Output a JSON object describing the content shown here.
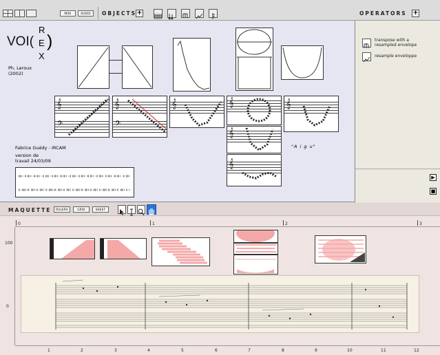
{
  "patch": {
    "toolbar": {
      "midi_label": "MIDI",
      "audio_label": "AUDIO",
      "objects_label": "OBJECTS",
      "add_symbol": "+"
    },
    "title": {
      "main": "VOI(",
      "letters": [
        "R",
        "E",
        "X"
      ],
      "close": ")",
      "author": "Ph. Leroux",
      "year": "(2002)"
    },
    "credits": {
      "line1": "Fabrice Guédy - IRCAM",
      "line2": "version de",
      "line3": "travail 24/03/09"
    },
    "aigu_label": "\"A i g u\"",
    "clef_symbol": "𝄞",
    "bass_symbol": "𝄢"
  },
  "operators": {
    "title": "OPERATORS",
    "add_symbol": "+",
    "items": [
      {
        "label_line1": "transpose with a",
        "label_line2": "resampled envelope",
        "icon": "transpose-icon"
      },
      {
        "label_line1": "resample enveloppe",
        "label_line2": "",
        "icon": "resample-icon"
      }
    ],
    "play_symbol": "▶",
    "stop_symbol": "■"
  },
  "maquette": {
    "title": "MAQUETTE",
    "buttons": [
      "RULERS",
      "GRID",
      "SHEET"
    ],
    "top_ruler": [
      "0",
      "1",
      "2",
      "3"
    ],
    "y_labels": [
      "100",
      "0"
    ],
    "bottom_ruler": [
      "1",
      "2",
      "3",
      "4",
      "5",
      "6",
      "7",
      "8",
      "9",
      "10",
      "11",
      "12"
    ]
  },
  "colors": {
    "patch_bg": "#e5e6f1",
    "operators_bg": "#ece9e0",
    "maquette_bg": "#efe4e2",
    "pink": "#f4a8a8",
    "accent_blue": "#2b74d9"
  }
}
